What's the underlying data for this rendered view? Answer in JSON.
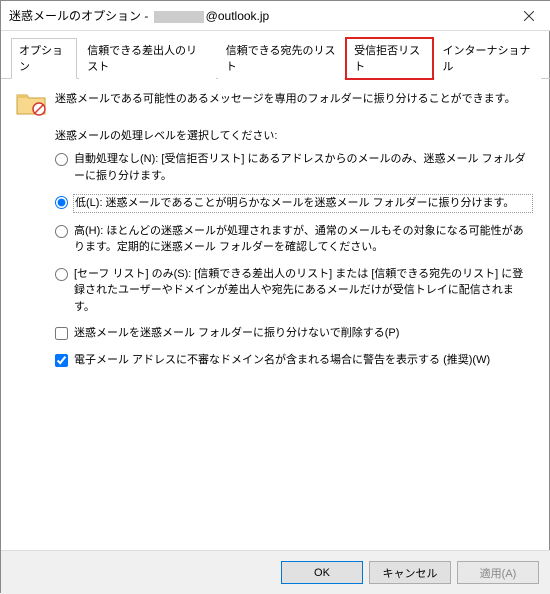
{
  "titlebar": {
    "prefix": "迷惑メールのオプション - ",
    "suffix": "@outlook.jp"
  },
  "tabs": {
    "option": "オプション",
    "safe_senders": "信頼できる差出人のリスト",
    "safe_recipients": "信頼できる宛先のリスト",
    "blocked": "受信拒否リスト",
    "international": "インターナショナル"
  },
  "content": {
    "intro": "迷惑メールである可能性のあるメッセージを専用のフォルダーに振り分けることができます。",
    "level_label": "迷惑メールの処理レベルを選択してください:",
    "radios": {
      "none": "自動処理なし(N): [受信拒否リスト] にあるアドレスからのメールのみ、迷惑メール フォルダーに振り分けます。",
      "low": "低(L): 迷惑メールであることが明らかなメールを迷惑メール フォルダーに振り分けます。",
      "high": "高(H): ほとんどの迷惑メールが処理されますが、通常のメールもその対象になる可能性があります。定期的に迷惑メール フォルダーを確認してください。",
      "safe": "[セーフ リスト] のみ(S): [信頼できる差出人のリスト] または [信頼できる宛先のリスト] に登録されたユーザーやドメインが差出人や宛先にあるメールだけが受信トレイに配信されます。"
    },
    "checks": {
      "delete": "迷惑メールを迷惑メール フォルダーに振り分けないで削除する(P)",
      "warn": "電子メール アドレスに不審なドメイン名が含まれる場合に警告を表示する (推奨)(W)"
    }
  },
  "footer": {
    "ok": "OK",
    "cancel": "キャンセル",
    "apply": "適用(A)"
  }
}
